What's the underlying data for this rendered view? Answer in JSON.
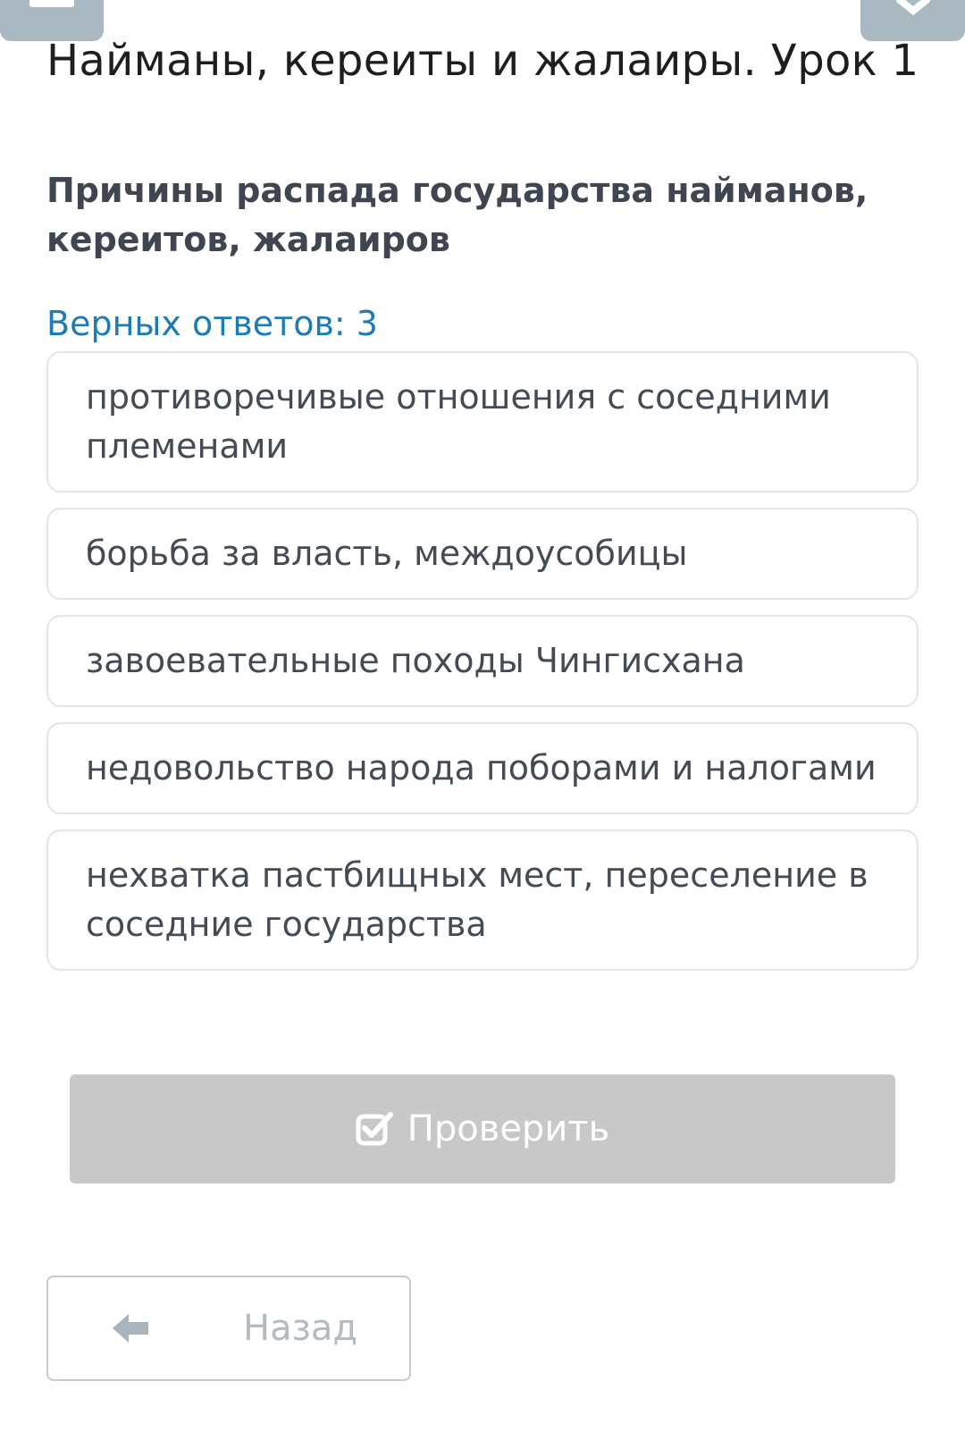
{
  "header": {
    "lesson_title": "Найманы, кереиты и жалаиры. Урок 1",
    "left_tab_icon": "menu-icon",
    "right_tab_icon": "close-icon"
  },
  "question": {
    "text": "Причины распада государства найманов, кереитов, жалаиров",
    "answers_count": "Верных ответов: 3"
  },
  "options": [
    "противоречивые отношения с соседними племенами",
    "борьба за власть, междоусобицы",
    "завоевательные походы Чингисхана",
    "недовольство народа поборами и налогами",
    "нехватка пастбищных мест, переселение в соседние государства"
  ],
  "actions": {
    "check_label": "Проверить",
    "check_icon": "checkbox-check-icon",
    "back_label": "Назад",
    "back_icon": "arrow-left-icon"
  },
  "colors": {
    "accent": "#1f7bb3",
    "disabled_button": "#c8c8c8",
    "top_tab": "#aab8c2"
  }
}
